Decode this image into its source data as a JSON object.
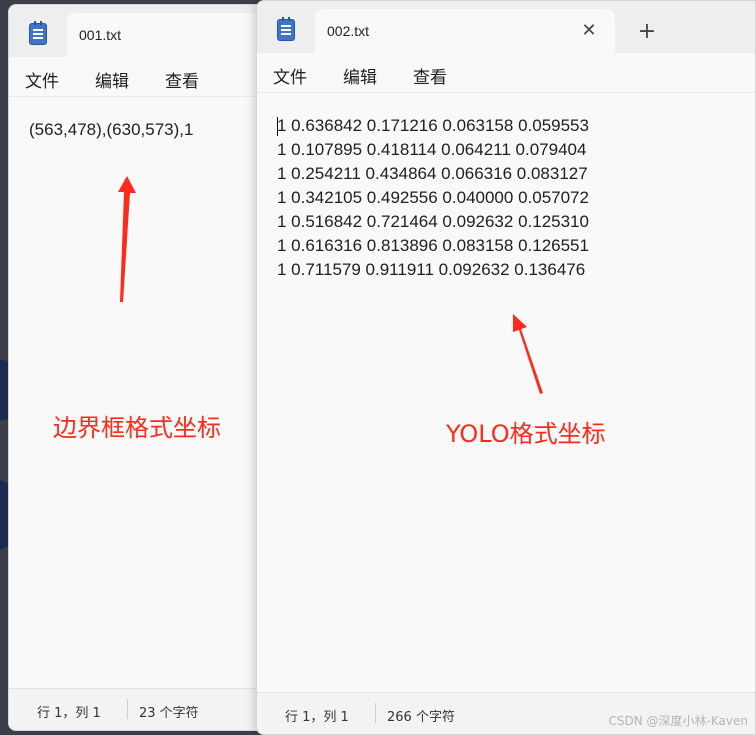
{
  "windows": [
    {
      "tab_title": "001.txt",
      "menu": [
        "文件",
        "编辑",
        "查看"
      ],
      "content": "(563,478),(630,573),1",
      "status": {
        "position": "行 1，列 1",
        "char_count": "23 个字符"
      }
    },
    {
      "tab_title": "002.txt",
      "menu": [
        "文件",
        "编辑",
        "查看"
      ],
      "content": "1 0.636842 0.171216 0.063158 0.059553\n1 0.107895 0.418114 0.064211 0.079404\n1 0.254211 0.434864 0.066316 0.083127\n1 0.342105 0.492556 0.040000 0.057072\n1 0.516842 0.721464 0.092632 0.125310\n1 0.616316 0.813896 0.083158 0.126551\n1 0.711579 0.911911 0.092632 0.136476",
      "status": {
        "position": "行 1，列 1",
        "char_count": "266 个字符"
      }
    }
  ],
  "annotations": [
    "边界框格式坐标",
    "YOLO格式坐标"
  ],
  "watermark": "CSDN @深度小林-Kaven",
  "icons": {
    "app": "notepad-icon",
    "close": "close-icon",
    "new_tab": "plus-icon"
  },
  "colors": {
    "annotation": "#ff2a1a",
    "window_bg": "#f9f9f9",
    "tabbar_bg": "#eeeeee"
  }
}
